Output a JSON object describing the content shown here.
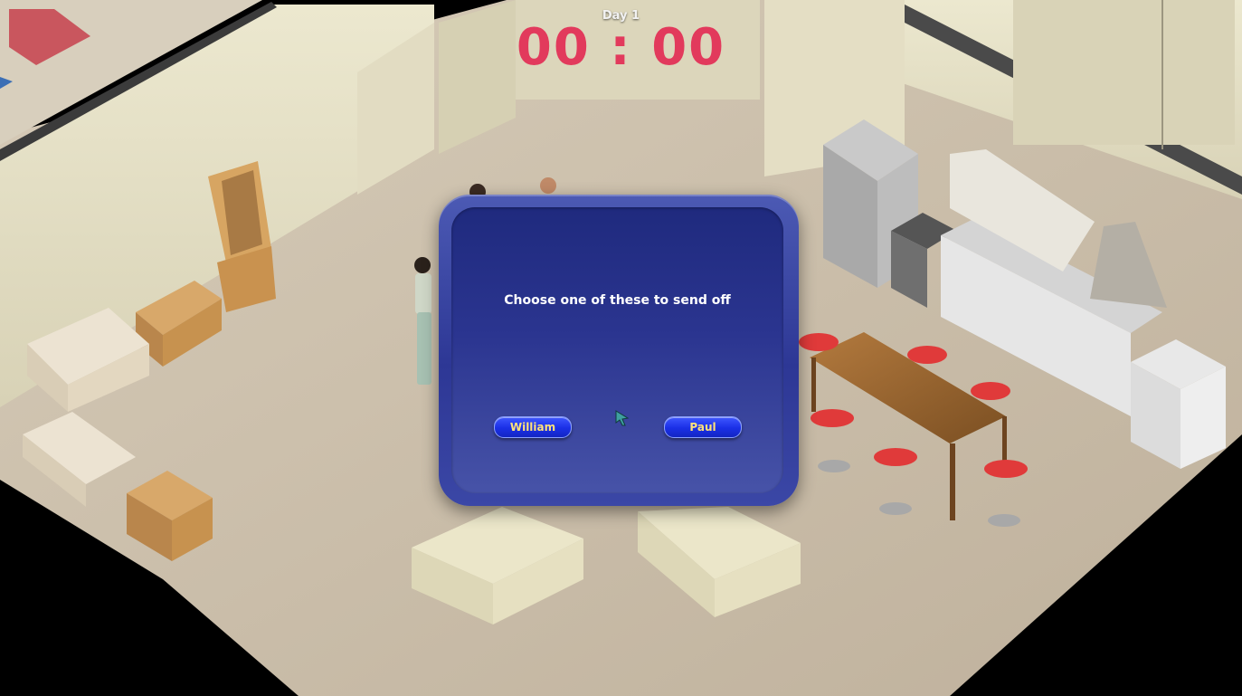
{
  "hud": {
    "day_label": "Day 1",
    "timer": "00 : 00"
  },
  "dialog": {
    "prompt": "Choose one of these to send off",
    "options": [
      {
        "label": "William"
      },
      {
        "label": "Paul"
      }
    ]
  },
  "colors": {
    "timer": "#e23a5c",
    "dialog_bg": "#2b3590",
    "button_bg": "#1a2fe6",
    "button_text": "#ffe27a",
    "floor": "#c9bca8",
    "wall": "#e7e2c9",
    "chairs": "#e03a3a"
  },
  "icons": {
    "cursor": "arrow-cursor-icon"
  }
}
